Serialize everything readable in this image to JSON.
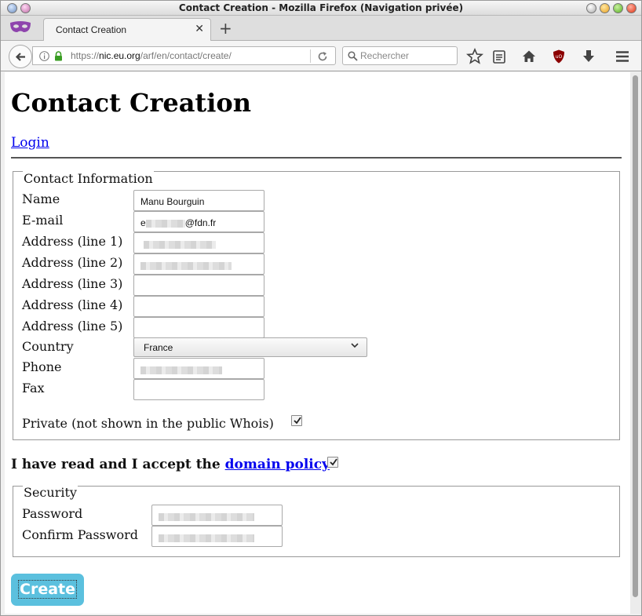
{
  "window": {
    "title": "Contact Creation - Mozilla Firefox (Navigation privée)"
  },
  "tab": {
    "label": "Contact Creation",
    "new_tab": "+"
  },
  "urlbar": {
    "scheme": "https://",
    "host": "nic.eu.org",
    "path": "/arf/en/contact/create/"
  },
  "search": {
    "placeholder": "Rechercher"
  },
  "page": {
    "title": "Contact Creation",
    "login_link": "Login",
    "contact": {
      "legend": "Contact Information",
      "name_label": "Name",
      "name_value": "Manu Bourguin",
      "email_label": "E-mail",
      "email_prefix": "e",
      "email_suffix": "@fdn.fr",
      "addr1_label": "Address (line 1)",
      "addr2_label": "Address (line 2)",
      "addr3_label": "Address (line 3)",
      "addr4_label": "Address (line 4)",
      "addr5_label": "Address (line 5)",
      "country_label": "Country",
      "country_value": "France",
      "phone_label": "Phone",
      "fax_label": "Fax",
      "private_label": "Private (not shown in the public Whois)",
      "private_checked": true
    },
    "policy": {
      "text": "I have read and I accept the ",
      "link": "domain policy",
      "checked": true
    },
    "security": {
      "legend": "Security",
      "password_label": "Password",
      "confirm_label": "Confirm Password"
    },
    "create_button": "Create"
  },
  "colors": {
    "button": "#5bc0de",
    "link": "#0000ee"
  }
}
